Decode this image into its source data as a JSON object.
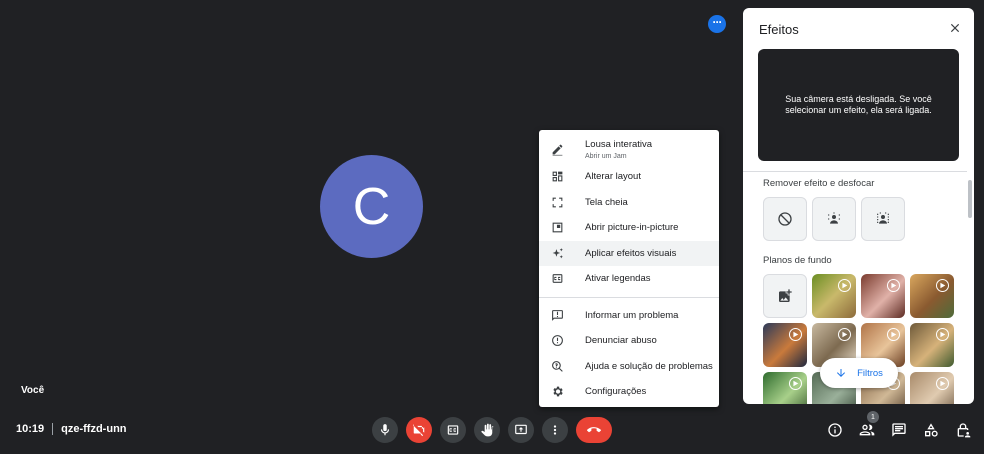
{
  "self": {
    "avatar_letter": "C",
    "tile_name": "Você"
  },
  "meeting": {
    "time": "10:19",
    "code": "qze-ffzd-unn"
  },
  "participants": {
    "count": "1"
  },
  "menu": {
    "items": [
      {
        "label": "Lousa interativa",
        "sub": "Abrir um Jam",
        "icon": "pencil-icon"
      },
      {
        "label": "Alterar layout",
        "icon": "layout-icon"
      },
      {
        "label": "Tela cheia",
        "icon": "fullscreen-icon"
      },
      {
        "label": "Abrir picture-in-picture",
        "icon": "pip-icon"
      },
      {
        "label": "Aplicar efeitos visuais",
        "icon": "sparkle-icon"
      },
      {
        "label": "Ativar legendas",
        "icon": "captions-icon"
      },
      {
        "label": "Informar um problema",
        "icon": "feedback-icon"
      },
      {
        "label": "Denunciar abuso",
        "icon": "report-icon"
      },
      {
        "label": "Ajuda e solução de problemas",
        "icon": "help-search-icon"
      },
      {
        "label": "Configurações",
        "icon": "gear-icon"
      }
    ]
  },
  "effects_panel": {
    "title": "Efeitos",
    "camera_off_message": "Sua câmera está desligada. Se você selecionar um efeito, ela será ligada.",
    "section_remove": "Remover efeito e desfocar",
    "section_backgrounds": "Planos de fundo",
    "filters_button": "Filtros"
  },
  "colors": {
    "bg": "#202124",
    "accent": "#1a73e8",
    "danger": "#ea4335",
    "avatar": "#5c6bc0"
  }
}
